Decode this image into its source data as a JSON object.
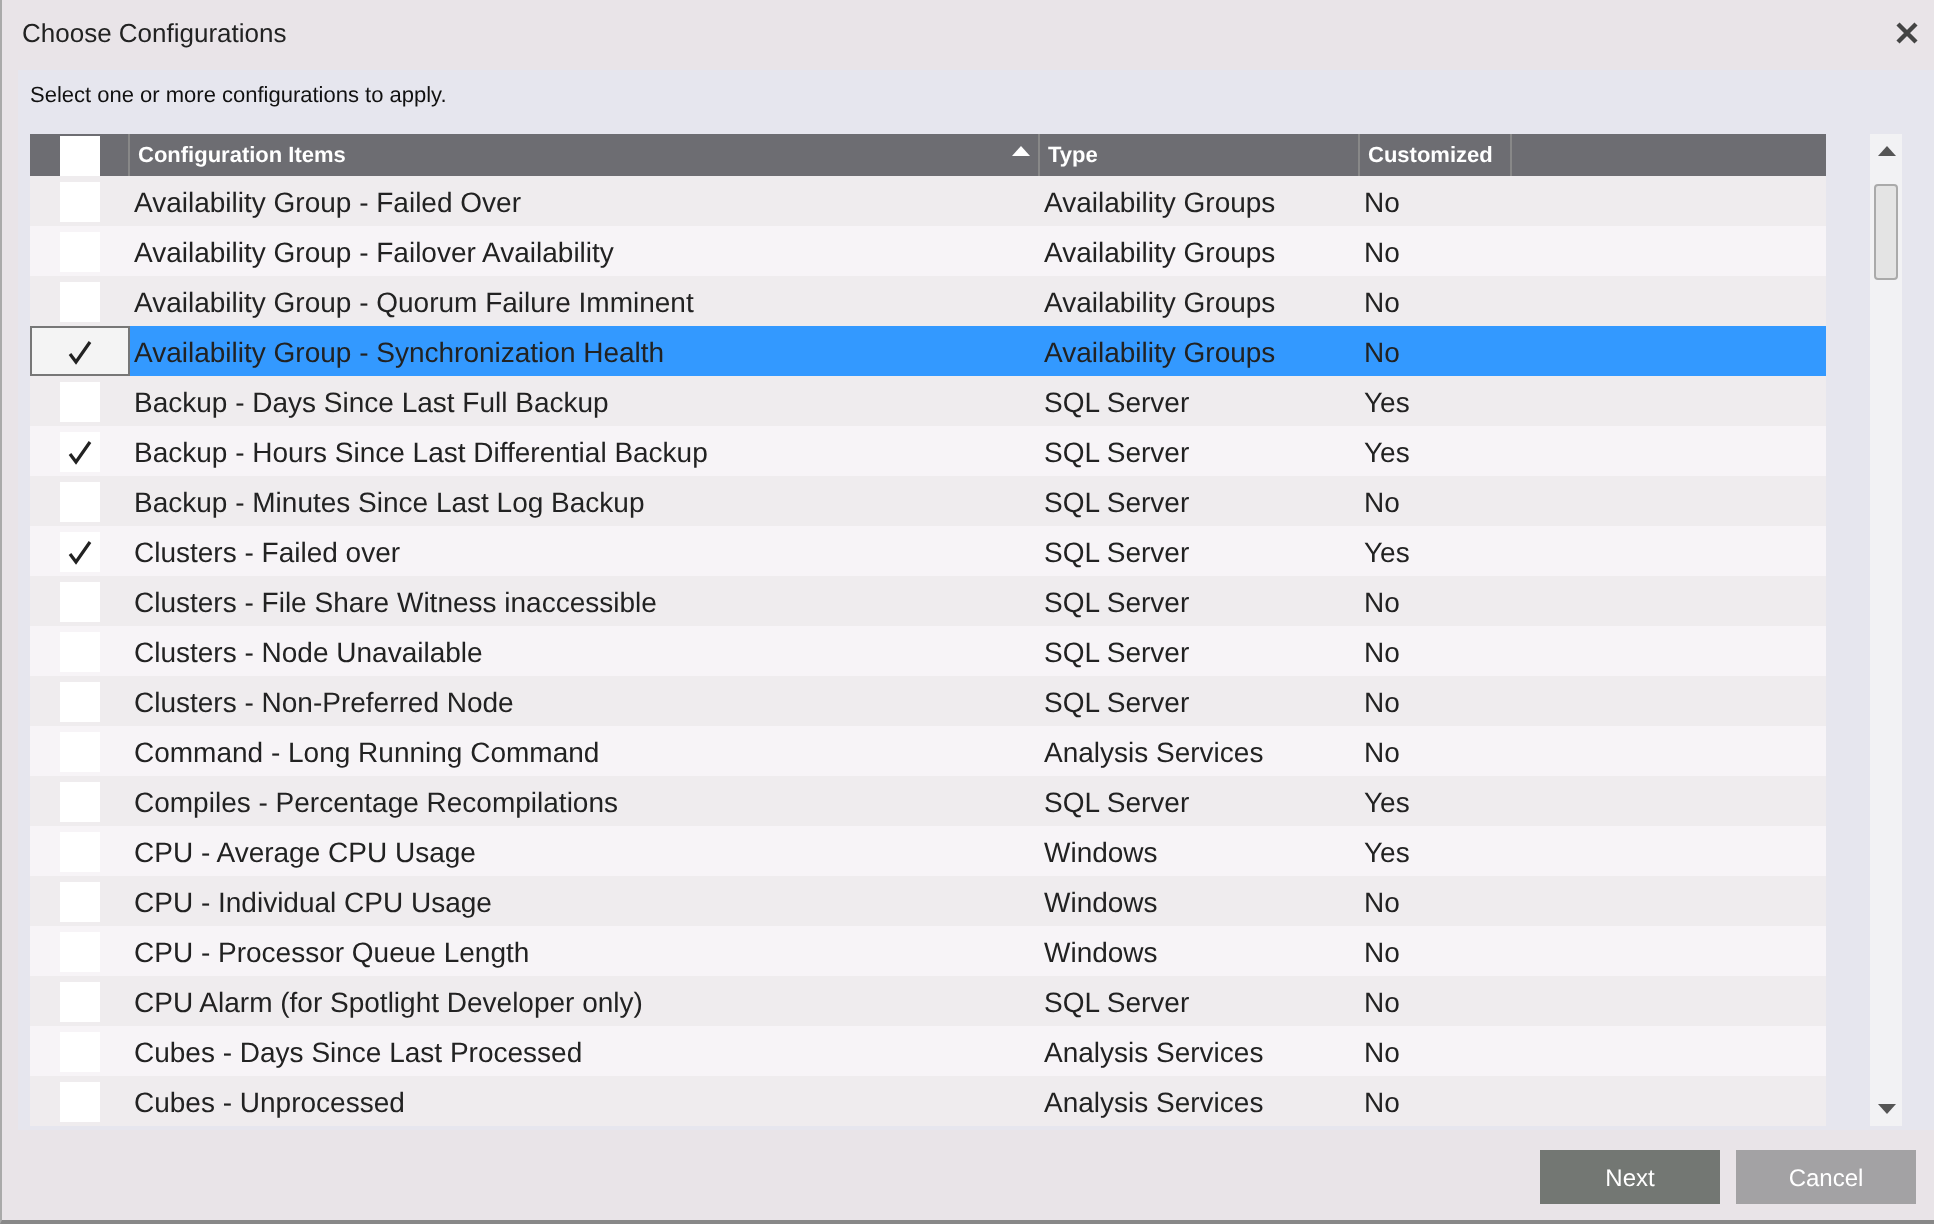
{
  "window": {
    "title": "Choose Configurations"
  },
  "instruction": "Select one or more configurations to apply.",
  "table": {
    "select_all": {
      "checked": false
    },
    "columns": [
      {
        "label": "Configuration Items",
        "sorted": true
      },
      {
        "label": "Type",
        "sorted": false
      },
      {
        "label": "Customized",
        "sorted": false
      }
    ],
    "rows": [
      {
        "item": "Availability Group - Failed Over",
        "type": "Availability Groups",
        "customized": "No",
        "checked": false,
        "selected": false
      },
      {
        "item": "Availability Group - Failover Availability",
        "type": "Availability Groups",
        "customized": "No",
        "checked": false,
        "selected": false
      },
      {
        "item": "Availability Group - Quorum Failure Imminent",
        "type": "Availability Groups",
        "customized": "No",
        "checked": false,
        "selected": false
      },
      {
        "item": "Availability Group - Synchronization Health",
        "type": "Availability Groups",
        "customized": "No",
        "checked": true,
        "selected": true
      },
      {
        "item": "Backup - Days Since Last Full Backup",
        "type": "SQL Server",
        "customized": "Yes",
        "checked": false,
        "selected": false
      },
      {
        "item": "Backup - Hours Since Last Differential Backup",
        "type": "SQL Server",
        "customized": "Yes",
        "checked": true,
        "selected": false
      },
      {
        "item": "Backup - Minutes Since Last Log Backup",
        "type": "SQL Server",
        "customized": "No",
        "checked": false,
        "selected": false
      },
      {
        "item": "Clusters - Failed over",
        "type": "SQL Server",
        "customized": "Yes",
        "checked": true,
        "selected": false
      },
      {
        "item": "Clusters - File Share Witness inaccessible",
        "type": "SQL Server",
        "customized": "No",
        "checked": false,
        "selected": false
      },
      {
        "item": "Clusters - Node Unavailable",
        "type": "SQL Server",
        "customized": "No",
        "checked": false,
        "selected": false
      },
      {
        "item": "Clusters - Non-Preferred Node",
        "type": "SQL Server",
        "customized": "No",
        "checked": false,
        "selected": false
      },
      {
        "item": "Command - Long Running Command",
        "type": "Analysis Services",
        "customized": "No",
        "checked": false,
        "selected": false
      },
      {
        "item": "Compiles - Percentage Recompilations",
        "type": "SQL Server",
        "customized": "Yes",
        "checked": false,
        "selected": false
      },
      {
        "item": "CPU - Average CPU Usage",
        "type": "Windows",
        "customized": "Yes",
        "checked": false,
        "selected": false
      },
      {
        "item": "CPU - Individual CPU Usage",
        "type": "Windows",
        "customized": "No",
        "checked": false,
        "selected": false
      },
      {
        "item": "CPU - Processor Queue Length",
        "type": "Windows",
        "customized": "No",
        "checked": false,
        "selected": false
      },
      {
        "item": "CPU Alarm (for Spotlight Developer only)",
        "type": "SQL Server",
        "customized": "No",
        "checked": false,
        "selected": false
      },
      {
        "item": "Cubes - Days Since Last Processed",
        "type": "Analysis Services",
        "customized": "No",
        "checked": false,
        "selected": false
      },
      {
        "item": "Cubes - Unprocessed",
        "type": "Analysis Services",
        "customized": "No",
        "checked": false,
        "selected": false
      }
    ]
  },
  "buttons": [
    {
      "label": "Next",
      "kind": "primary"
    },
    {
      "label": "Cancel",
      "kind": "secondary"
    }
  ]
}
